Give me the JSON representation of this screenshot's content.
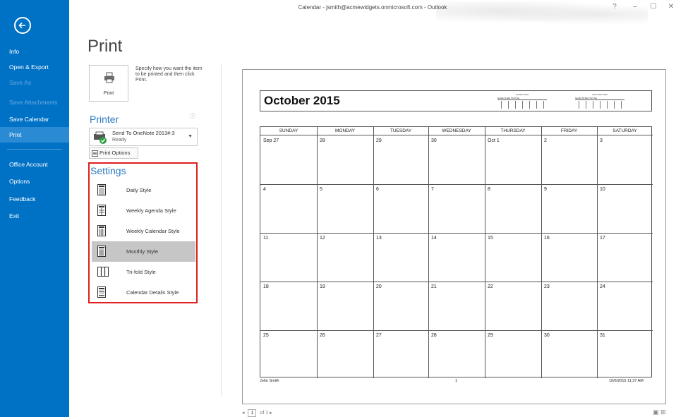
{
  "window": {
    "title": "Calendar - jsmith@acmewidgets.onmicrosoft.com - Outlook",
    "help": "?",
    "minimize": "–",
    "maximize": "☐",
    "close": "✕"
  },
  "nav": {
    "back_icon": "back-arrow-icon",
    "items": [
      {
        "label": "Info",
        "state": "normal"
      },
      {
        "label": "Open & Export",
        "state": "normal"
      },
      {
        "label": "Save As",
        "state": "disabled"
      },
      {
        "label": "Save Attachments",
        "state": "disabled"
      },
      {
        "label": "Save Calendar",
        "state": "normal"
      },
      {
        "label": "Print",
        "state": "selected"
      },
      {
        "label": "Office Account",
        "state": "normal"
      },
      {
        "label": "Options",
        "state": "normal"
      },
      {
        "label": "Feedback",
        "state": "normal"
      },
      {
        "label": "Exit",
        "state": "normal"
      }
    ],
    "colors": {
      "background": "#0072c6",
      "selected": "#2a8ad4"
    }
  },
  "print_panel": {
    "heading": "Print",
    "print_button_label": "Print",
    "print_description": "Specify how you want the item to be printed and then click Print.",
    "printer_section_title": "Printer",
    "info_icon": "info-icon",
    "printer_name": "Send To OneNote 2013#:3",
    "printer_status": "Ready",
    "print_options_label": "Print Options",
    "settings_section_title": "Settings",
    "styles": [
      {
        "label": "Daily Style",
        "icon": "daily-style-icon",
        "selected": false
      },
      {
        "label": "Weekly Agenda Style",
        "icon": "weekly-agenda-style-icon",
        "selected": false
      },
      {
        "label": "Weekly Calendar Style",
        "icon": "weekly-calendar-style-icon",
        "selected": false
      },
      {
        "label": "Monthly Style",
        "icon": "monthly-style-icon",
        "selected": true
      },
      {
        "label": "Tri-fold Style",
        "icon": "trifold-style-icon",
        "selected": false
      },
      {
        "label": "Calendar Details Style",
        "icon": "calendar-details-style-icon",
        "selected": false
      }
    ],
    "highlight_color": "#e01e1e"
  },
  "preview": {
    "month_title": "October 2015",
    "mini_calendars": [
      {
        "title": "October 2015",
        "days": "Su Mo Tu We Th Fr Sa"
      },
      {
        "title": "November 2015",
        "days": "Su Mo Tu We Th Fr Sa"
      }
    ],
    "day_headers": [
      "SUNDAY",
      "MONDAY",
      "TUESDAY",
      "WEDNESDAY",
      "THURSDAY",
      "FRIDAY",
      "SATURDAY"
    ],
    "weeks": [
      [
        "Sep 27",
        "28",
        "29",
        "30",
        "Oct 1",
        "2",
        "3"
      ],
      [
        "4",
        "5",
        "6",
        "7",
        "8",
        "9",
        "10"
      ],
      [
        "11",
        "12",
        "13",
        "14",
        "15",
        "16",
        "17"
      ],
      [
        "18",
        "19",
        "20",
        "21",
        "22",
        "23",
        "24"
      ],
      [
        "25",
        "26",
        "27",
        "28",
        "29",
        "30",
        "31"
      ]
    ],
    "footer": {
      "owner": "John Smith",
      "page": "1",
      "printed": "10/6/2015 11:37 AM"
    }
  },
  "pager": {
    "prev": "◂",
    "current_page": "1",
    "of_label": "of 1",
    "next": "▸"
  }
}
